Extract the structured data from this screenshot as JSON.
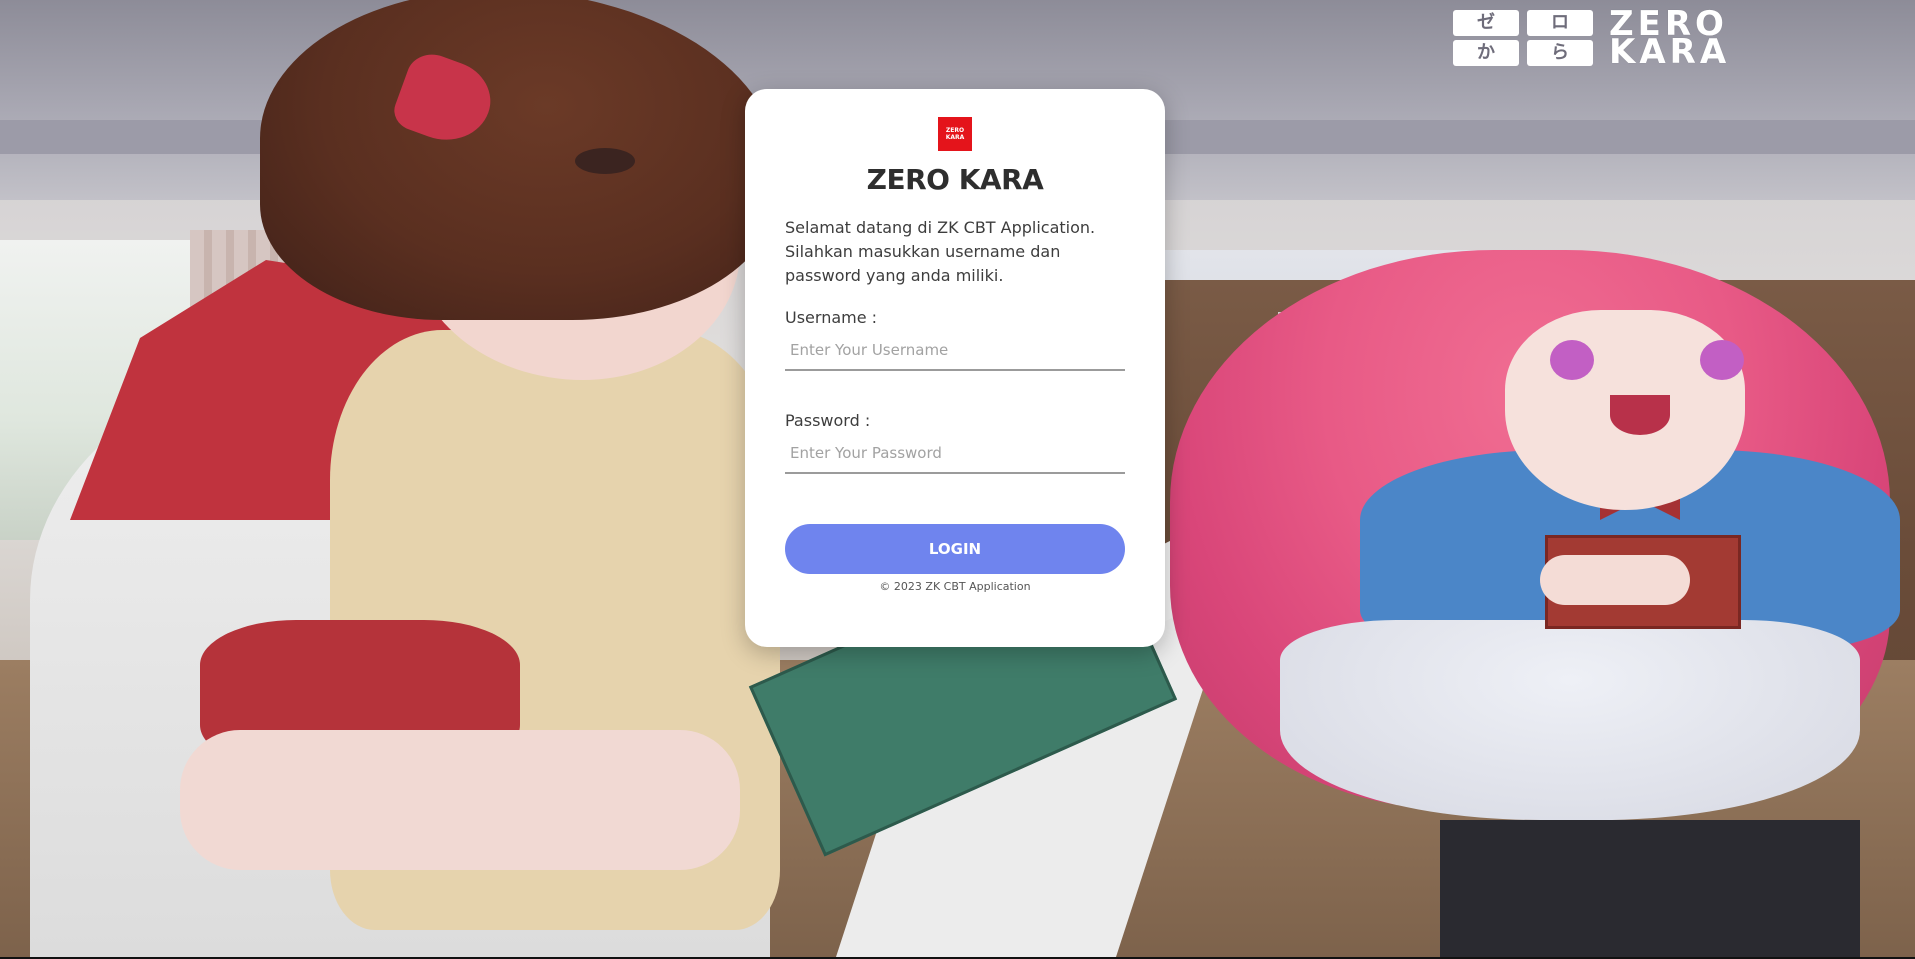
{
  "brand": {
    "tiles": [
      "ゼ",
      "ロ",
      "か",
      "ら"
    ],
    "words": [
      "ZERO",
      "KARA"
    ]
  },
  "card": {
    "logo_lines": [
      "ZERO",
      "KARA"
    ],
    "title": "ZERO KARA",
    "welcome_text": "Selamat datang di ZK CBT Application. Silahkan masukkan username dan password yang anda miliki.",
    "username": {
      "label": "Username :",
      "placeholder": "Enter Your Username",
      "value": ""
    },
    "password": {
      "label": "Password :",
      "placeholder": "Enter Your Password",
      "value": ""
    },
    "login_label": "LOGIN",
    "copyright": "© 2023 ZK CBT Application"
  },
  "colors": {
    "login_button": "#6f84ee",
    "logo_red": "#e4141b",
    "card_background": "#ffffff"
  }
}
